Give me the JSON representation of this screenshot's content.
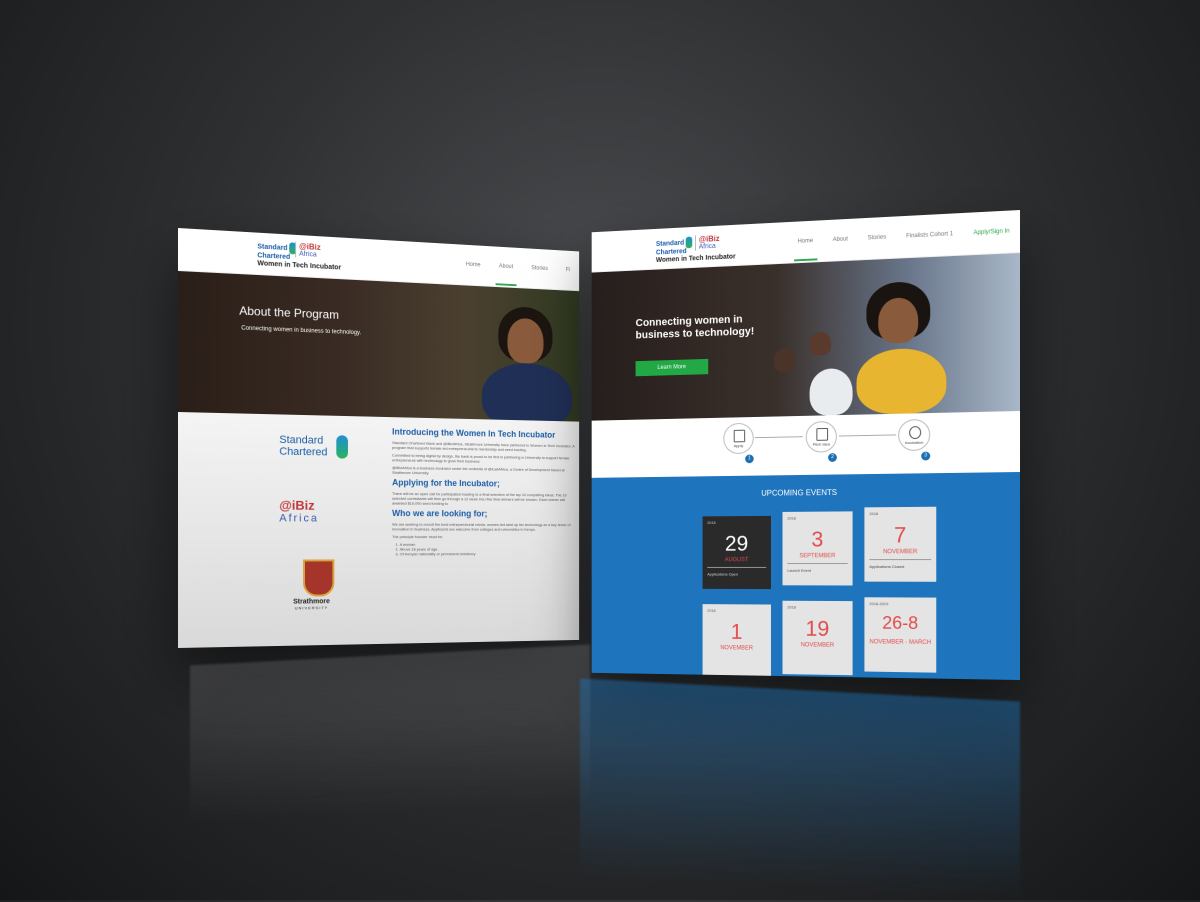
{
  "brand": {
    "standard_chartered_line1": "Standard",
    "standard_chartered_line2": "Chartered",
    "ibiz_line1": "@iBiz",
    "ibiz_line2": "Africa",
    "tagline": "Women in Tech Incubator"
  },
  "left_page": {
    "nav": [
      "Home",
      "About",
      "Stories",
      "Fi"
    ],
    "active_nav": "About",
    "hero_title": "About the Program",
    "hero_subtitle": "Connecting women in business to technology.",
    "strathmore_name": "Strathmore",
    "strathmore_sub": "UNIVERSITY",
    "sections": [
      {
        "heading": "Introducing the Women In Tech Incubator",
        "paragraphs": [
          "Standard Chartered Bank and @iBizAfrica, Strathmore University have partnered to Women in Tech Incubator. A program that supports female-led entrepreneurial te mentorship and seed funding.",
          "Committed to being digital by design, the bank is proud to be first in partnering w University to support female entrepreneurs with technology to grow their business",
          "@iBizAfrica is a business incubator under the umbrella of @iLabAfrica, a Centre of Development based at Strathmore University."
        ]
      },
      {
        "heading": "Applying for the Incubator;",
        "paragraphs": [
          "There will be an open call for participation leading to a final selection of the top 10 compelling ideas. The 10 selected contestants will then go through a 12 week incu five final winners will be chosen. Each winner will awarded $10,000 seed funding to"
        ]
      },
      {
        "heading": "Who we are looking for;",
        "paragraphs": [
          "We are seeking to recruit the best entrepreneurial minds, women-led start up tec technology as a key driver of innovation in business. Applicants are welcome from colleges and universities in Kenya.",
          "The principle founder must be:"
        ]
      }
    ],
    "criteria": [
      "A woman",
      "Above 18 years of age.",
      "Of Kenyan nationality or permanent residency"
    ]
  },
  "right_page": {
    "nav": [
      "Home",
      "About",
      "Stories",
      "Finalists Cohort 1",
      "Apply/Sign In"
    ],
    "active_nav": "Home",
    "hero_title": "Connecting women in business to technology!",
    "cta_label": "Learn More",
    "steps": [
      {
        "label": "Apply",
        "number": "1"
      },
      {
        "label": "Pitch Idea",
        "number": "2"
      },
      {
        "label": "Incubation",
        "number": "3"
      }
    ],
    "events_title": "UPCOMING EVENTS",
    "events": [
      {
        "year": "2018",
        "day": "29",
        "month": "AUGUST",
        "desc": "Applications Open",
        "dark": true
      },
      {
        "year": "2018",
        "day": "3",
        "month": "SEPTEMBER",
        "desc": "Launch Event",
        "dark": false
      },
      {
        "year": "2018",
        "day": "7",
        "month": "NOVEMBER",
        "desc": "Applications Closed",
        "dark": false
      },
      {
        "year": "2018",
        "day": "1",
        "month": "NOVEMBER",
        "desc": "",
        "dark": false
      },
      {
        "year": "2018",
        "day": "19",
        "month": "NOVEMBER",
        "desc": "",
        "dark": false
      },
      {
        "year": "2018-2019",
        "day": "26-8",
        "month": "NOVEMBER - MARCH",
        "desc": "",
        "dark": false
      }
    ]
  },
  "colors": {
    "accent_green": "#2ea84a",
    "events_blue": "#1e75bd",
    "date_red": "#e24b4b",
    "heading_blue": "#1a5ea8"
  }
}
